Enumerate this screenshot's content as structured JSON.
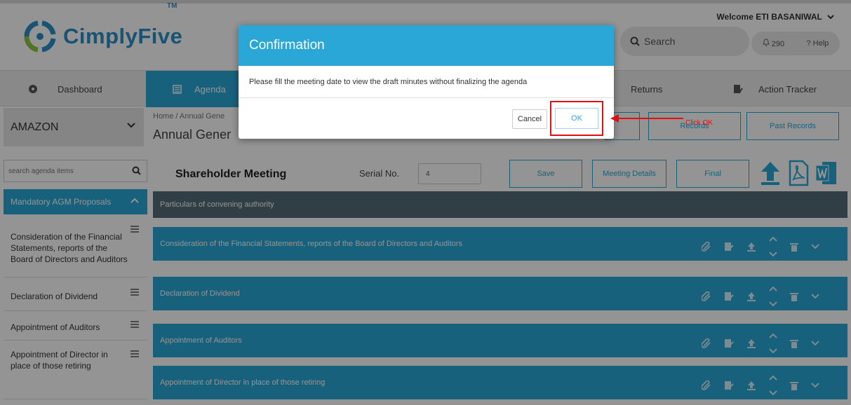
{
  "header": {
    "brand": "CimplyFive",
    "tm": "TM",
    "welcome": "Welcome ETI BASANIWAL",
    "search_label": "Search",
    "notifications_count": "290",
    "help_label": "Help"
  },
  "nav": {
    "items": [
      {
        "label": "Dashboard"
      },
      {
        "label": "Agenda"
      },
      {
        "label": "Returns"
      },
      {
        "label": "Action Tracker"
      }
    ]
  },
  "company": {
    "name": "AMAZON"
  },
  "breadcrumb": "Home / Annual Gene",
  "page_title": "Annual Gener",
  "top_buttons": {
    "records": "Records",
    "past_records": "Past Records"
  },
  "sidebar": {
    "search_placeholder": "search agenda items",
    "section_title": "Mandatory AGM Proposals",
    "items": [
      {
        "label": "Consideration of the Financial Statements, reports of the Board of Directors and Auditors"
      },
      {
        "label": "Declaration of Dividend"
      },
      {
        "label": "Appointment of Auditors"
      },
      {
        "label": "Appointment of Director in place of those retiring"
      }
    ]
  },
  "main": {
    "title": "Shareholder Meeting",
    "serial_label": "Serial No.",
    "serial_value": "4",
    "save_label": "Save",
    "meeting_details_label": "Meeting Details",
    "final_label": "Final",
    "particulars": "Particulars of convening authority",
    "agenda_items": [
      {
        "label": "Consideration of the Financial Statements, reports of the Board of Directors and Auditors"
      },
      {
        "label": "Declaration of Dividend"
      },
      {
        "label": "Appointment of Auditors"
      },
      {
        "label": "Appointment of Director in place of those retiring"
      }
    ]
  },
  "modal": {
    "title": "Confirmation",
    "message": "Please fill the meeting date to view the draft minutes without finalizing the agenda",
    "cancel_label": "Cancel",
    "ok_label": "OK"
  },
  "annotation": {
    "text": "Click OK",
    "color": "#e01010"
  },
  "colors": {
    "accent": "#2aa7d6",
    "particulars_bar": "#546b78",
    "brand": "#2a8fc9"
  }
}
